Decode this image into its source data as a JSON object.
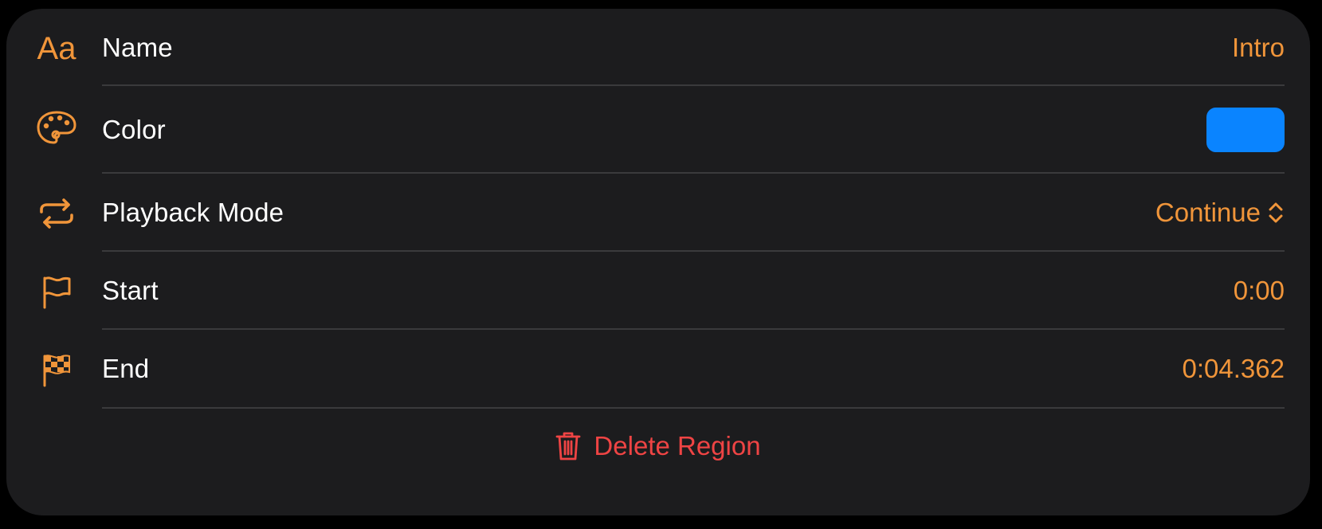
{
  "colors": {
    "accent": "#f0953a",
    "destructive": "#ef4444",
    "card_background": "#1c1c1e",
    "divider": "#3a3a3c",
    "region_color": "#0a84ff"
  },
  "rows": [
    {
      "icon": "text-format-icon",
      "icon_text": "Aa",
      "label": "Name",
      "value": "Intro"
    },
    {
      "icon": "palette-icon",
      "label": "Color",
      "value_color": "#0a84ff"
    },
    {
      "icon": "repeat-icon",
      "label": "Playback Mode",
      "value": "Continue",
      "value_icon": "chevron-up-down-icon"
    },
    {
      "icon": "flag-icon",
      "label": "Start",
      "value": "0:00"
    },
    {
      "icon": "checkered-flag-icon",
      "label": "End",
      "value": "0:04.362"
    }
  ],
  "delete": {
    "icon": "trash-icon",
    "label": "Delete Region"
  }
}
